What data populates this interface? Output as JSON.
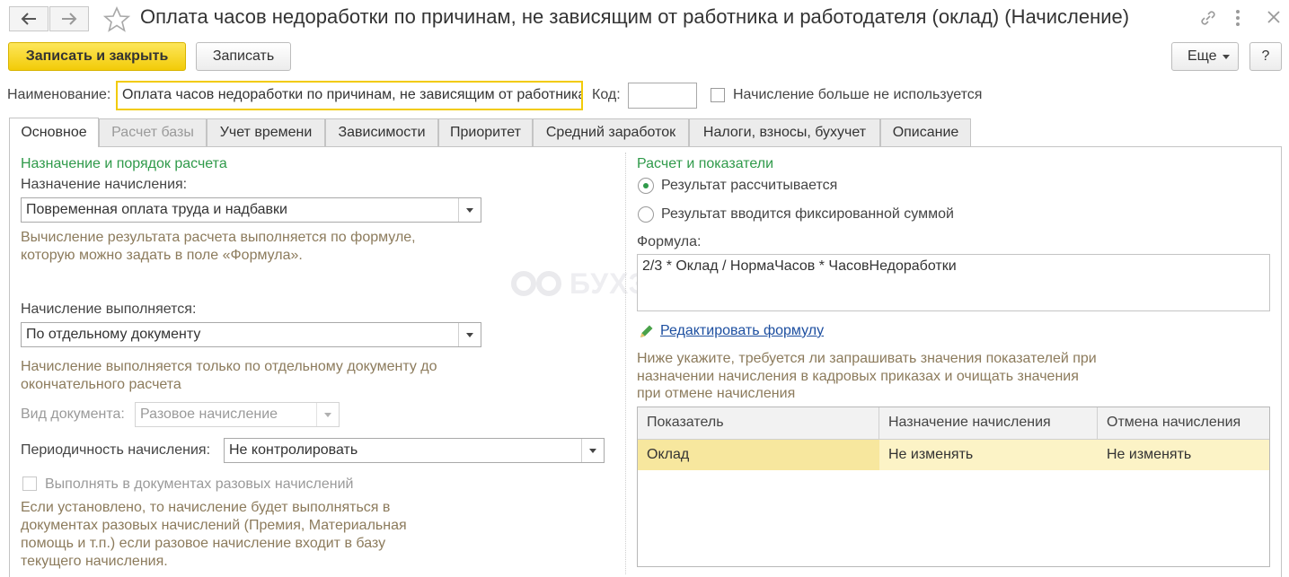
{
  "window": {
    "title": "Оплата часов недоработки по причинам, не зависящим от работника и работодателя (оклад) (Начисление)"
  },
  "toolbar": {
    "save_close_label": "Записать и закрыть",
    "save_label": "Записать",
    "more_label": "Еще",
    "help_label": "?"
  },
  "header": {
    "name_label": "Наименование:",
    "name_value": "Оплата часов недоработки по причинам, не зависящим от работника и работодателя (оклад)",
    "code_label": "Код:",
    "code_value": "",
    "not_used_label": "Начисление больше не используется"
  },
  "tabs": [
    {
      "label": "Основное"
    },
    {
      "label": "Расчет базы"
    },
    {
      "label": "Учет времени"
    },
    {
      "label": "Зависимости"
    },
    {
      "label": "Приоритет"
    },
    {
      "label": "Средний заработок"
    },
    {
      "label": "Налоги, взносы, бухучет"
    },
    {
      "label": "Описание"
    }
  ],
  "left": {
    "section_title": "Назначение и порядок расчета",
    "purpose_label": "Назначение начисления:",
    "purpose_value": "Повременная оплата труда и надбавки",
    "purpose_hint": "Вычисление результата расчета выполняется по формуле, которую можно задать в поле «Формула».",
    "executed_label": "Начисление выполняется:",
    "executed_value": "По отдельному документу",
    "executed_hint": "Начисление выполняется только по отдельному документу до окончательного расчета",
    "doc_type_label": "Вид документа:",
    "doc_type_value": "Разовое начисление",
    "periodicity_label": "Периодичность начисления:",
    "periodicity_value": "Не контролировать",
    "one_time_label": "Выполнять в документах разовых начислений",
    "one_time_hint": "Если установлено, то начисление будет выполняться в документах разовых начислений (Премия, Материальная помощь и т.п.) если разовое начисление входит в базу текущего начисления."
  },
  "right": {
    "section_title": "Расчет и показатели",
    "radio_calculated": "Результат рассчитывается",
    "radio_fixed": "Результат вводится фиксированной суммой",
    "formula_label": "Формула:",
    "formula_value": "2/3 * Оклад / НормаЧасов * ЧасовНедоработки",
    "edit_formula_link": "Редактировать формулу",
    "indicators_hint": "Ниже укажите, требуется ли запрашивать значения показателей при назначении начисления в кадровых приказах и очищать значения при отмене начисления"
  },
  "table": {
    "columns": [
      "Показатель",
      "Назначение начисления",
      "Отмена начисления"
    ],
    "rows": [
      [
        "Оклад",
        "Не изменять",
        "Не изменять"
      ]
    ]
  },
  "watermark": "БУХЭКСПЕРТ",
  "colors": {
    "accent_yellow": "#f2cb08",
    "section_green": "#2f9a4a",
    "hint_brown": "#8c7b5c",
    "link_blue": "#1d4fa0",
    "row_highlight": "#fcf3c6"
  }
}
